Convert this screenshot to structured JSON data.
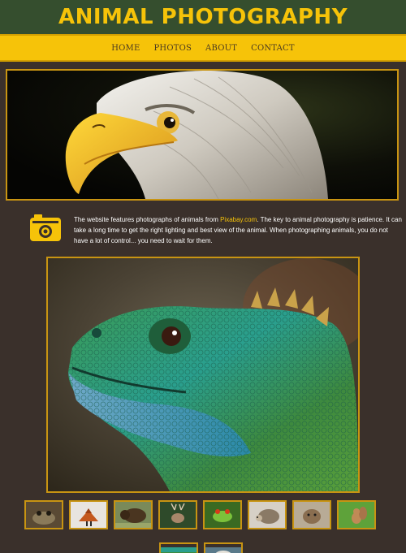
{
  "header": {
    "title": "ANIMAL PHOTOGRAPHY"
  },
  "nav": {
    "items": [
      "HOME",
      "PHOTOS",
      "ABOUT",
      "CONTACT"
    ]
  },
  "hero": {
    "subject": "bald-eagle-photo"
  },
  "intro": {
    "icon": "camera-icon",
    "text_before": "The website features photographs of animals from ",
    "link": "Pixabay.com",
    "text_after": ". The key to animal photography is patience. It can take a long time to get the right lighting and best view of the animal. When photographing animals, you do not have a lot of control... you need to wait for them."
  },
  "feature": {
    "subject": "green-lizard-photo"
  },
  "thumbnails": [
    {
      "subject": "frog"
    },
    {
      "subject": "fox"
    },
    {
      "subject": "bison"
    },
    {
      "subject": "deer"
    },
    {
      "subject": "tree-frog"
    },
    {
      "subject": "hedgehog"
    },
    {
      "subject": "otter"
    },
    {
      "subject": "squirrel"
    },
    {
      "subject": "lizard"
    },
    {
      "subject": "eagle"
    }
  ],
  "colors": {
    "header_bg": "#354e2e",
    "accent": "#f6c309",
    "page_bg": "#3a302b",
    "frame": "#c89412"
  }
}
